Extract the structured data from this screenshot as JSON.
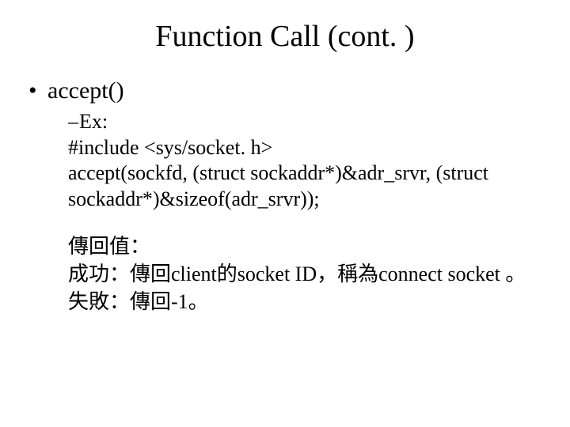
{
  "slide": {
    "title": "Function Call (cont. )",
    "bullet": "accept()",
    "ex_label": "Ex:",
    "include_line": "#include <sys/socket. h>",
    "code_line": "accept(sockfd, (struct sockaddr*)&adr_srvr, (struct sockaddr*)&sizeof(adr_srvr));",
    "ret_heading": "傳回值：",
    "ret_success": "成功：傳回client的socket ID，稱為connect socket 。",
    "ret_fail": "失敗：傳回-1。"
  }
}
